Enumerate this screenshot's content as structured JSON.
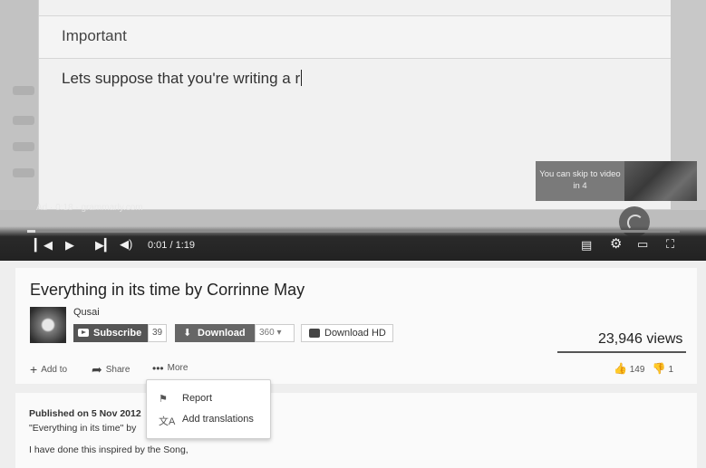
{
  "player": {
    "doc_heading": "Important",
    "doc_text": "Lets suppose that you're writing a r",
    "ad_label": "Ad · 0:18 · grammarly.com",
    "skip_text": "You can skip to video in 4",
    "time": "0:01 / 1:19",
    "progress_fraction": 0.013
  },
  "video": {
    "title": "Everything in its time by Corrinne May",
    "channel": "Qusai",
    "subscribe_label": "Subscribe",
    "subscriber_count": "39",
    "download_label": "Download",
    "quality": "360",
    "download_hd_label": "Download HD",
    "views": "23,946 views",
    "actions": {
      "add_to": "Add to",
      "share": "Share",
      "more": "More"
    },
    "likes": "149",
    "dislikes": "1"
  },
  "more_menu": {
    "items": [
      {
        "label": "Report",
        "icon": "flag-icon"
      },
      {
        "label": "Add translations",
        "icon": "translate-icon"
      }
    ]
  },
  "description": {
    "published": "Published on 5 Nov 2012",
    "line1": "\"Everything in its time\" by",
    "line2": "I have done this inspired by the Song,"
  }
}
